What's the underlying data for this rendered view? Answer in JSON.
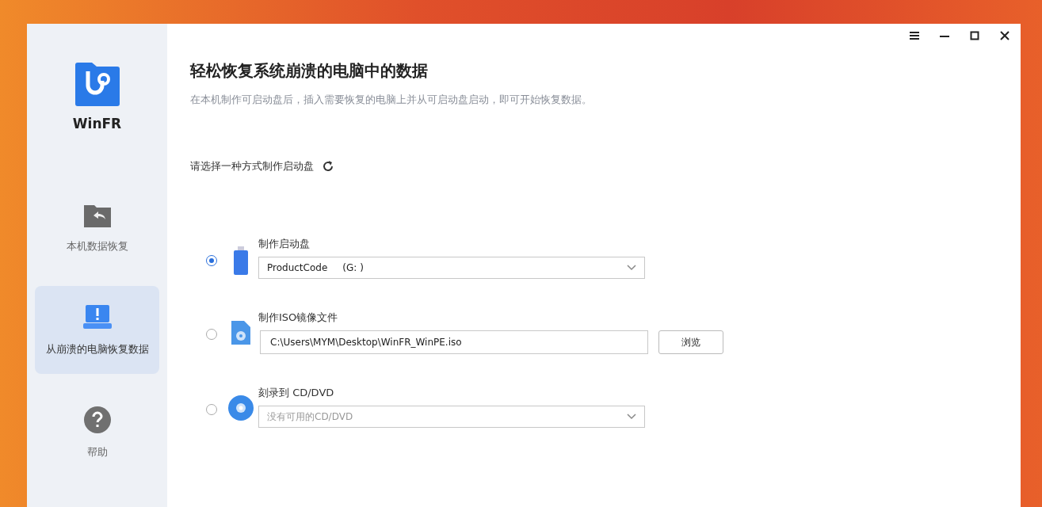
{
  "app": {
    "name": "WinFR"
  },
  "sidebar": {
    "items": [
      {
        "kind": "local",
        "label": "本机数据恢复",
        "selected": false
      },
      {
        "kind": "crashed",
        "label": "从崩溃的电脑恢复数据",
        "selected": true
      },
      {
        "kind": "help",
        "label": "帮助",
        "selected": false
      }
    ]
  },
  "main": {
    "title": "轻松恢复系统崩溃的电脑中的数据",
    "subtitle": "在本机制作可启动盘后，插入需要恢复的电脑上并从可启动盘启动，即可开始恢复数据。",
    "prompt": "请选择一种方式制作启动盘"
  },
  "options": [
    {
      "kind": "usb",
      "label": "制作启动盘",
      "selected": true,
      "field": {
        "kind": "dropdown",
        "value": "ProductCode     (G: )",
        "disabled": false
      }
    },
    {
      "kind": "iso",
      "label": "制作ISO镜像文件",
      "selected": false,
      "field": {
        "kind": "path",
        "value": "C:\\Users\\MYM\\Desktop\\WinFR_WinPE.iso",
        "button": "浏览"
      }
    },
    {
      "kind": "disc",
      "label": "刻录到 CD/DVD",
      "selected": false,
      "field": {
        "kind": "dropdown",
        "value": "没有可用的CD/DVD",
        "disabled": true
      }
    }
  ]
}
